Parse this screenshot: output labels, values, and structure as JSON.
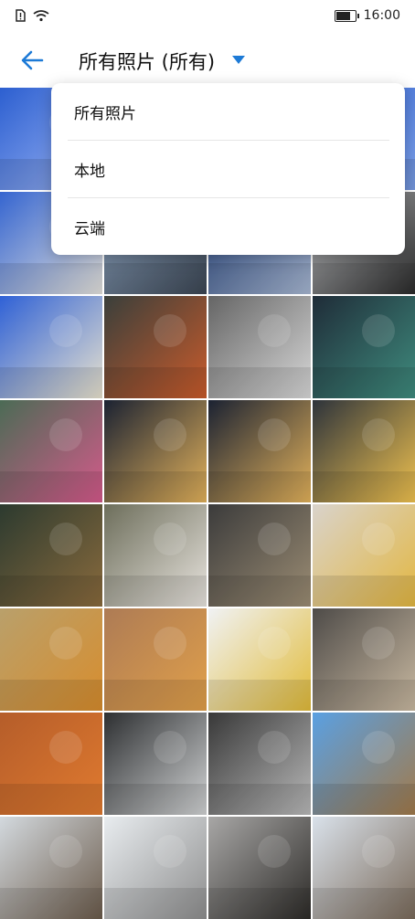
{
  "status_bar": {
    "time": "16:00",
    "icons": [
      "sim-alert-icon",
      "wifi-icon",
      "battery-icon"
    ]
  },
  "header": {
    "back_icon": "back-arrow-icon",
    "title": "所有照片 (所有)",
    "dropdown_icon": "caret-down-icon",
    "accent": "#1d7ad6"
  },
  "dropdown": {
    "options": [
      "所有照片",
      "本地",
      "云端"
    ]
  },
  "photos": [
    {
      "colors": [
        "#2c5fd0",
        "#9fb7f5"
      ]
    },
    {
      "colors": [
        "#2e5fce",
        "#7da1ea"
      ]
    },
    {
      "colors": [
        "#2e5fce",
        "#7da1ea"
      ]
    },
    {
      "colors": [
        "#2e5fce",
        "#7da1ea"
      ]
    },
    {
      "colors": [
        "#3565d0",
        "#e4e2dd"
      ]
    },
    {
      "colors": [
        "#8ea6c3",
        "#3b4552"
      ]
    },
    {
      "colors": [
        "#1f3c74",
        "#a7b7d2"
      ]
    },
    {
      "colors": [
        "#bfc1c4",
        "#2a2a2a"
      ]
    },
    {
      "colors": [
        "#2f61d6",
        "#e9e3cf"
      ]
    },
    {
      "colors": [
        "#3a3f3b",
        "#c95b2b"
      ]
    },
    {
      "colors": [
        "#656565",
        "#d8d8d8"
      ]
    },
    {
      "colors": [
        "#1f2c38",
        "#3f8c7e"
      ]
    },
    {
      "colors": [
        "#4b6b55",
        "#d55a8b"
      ]
    },
    {
      "colors": [
        "#1b2232",
        "#e3b25b"
      ]
    },
    {
      "colors": [
        "#1b2232",
        "#e3b25b"
      ]
    },
    {
      "colors": [
        "#2d333b",
        "#f0c24f"
      ]
    },
    {
      "colors": [
        "#2c3a2f",
        "#8a6b3d"
      ]
    },
    {
      "colors": [
        "#6d6e5b",
        "#e8e4de"
      ]
    },
    {
      "colors": [
        "#3b3b3b",
        "#9c8d74"
      ]
    },
    {
      "colors": [
        "#d9d3cb",
        "#e3b741"
      ]
    },
    {
      "colors": [
        "#b9a06b",
        "#d88d2d"
      ]
    },
    {
      "colors": [
        "#ad7b55",
        "#e1a04a"
      ]
    },
    {
      "colors": [
        "#f0f2f4",
        "#e1bb39"
      ]
    },
    {
      "colors": [
        "#4e4b48",
        "#c9b9a1"
      ]
    },
    {
      "colors": [
        "#b55d2a",
        "#e07a2f"
      ]
    },
    {
      "colors": [
        "#2d2f31",
        "#d1d3d4"
      ]
    },
    {
      "colors": [
        "#383838",
        "#b9b9b9"
      ]
    },
    {
      "colors": [
        "#5aa0e2",
        "#a27a4a"
      ]
    },
    {
      "colors": [
        "#d3d9de",
        "#6b5b4b"
      ]
    },
    {
      "colors": [
        "#e8ecef",
        "#8e8e8e"
      ]
    },
    {
      "colors": [
        "#a8a7a6",
        "#2d2b28"
      ]
    },
    {
      "colors": [
        "#d9e1ea",
        "#7a6a5a"
      ]
    }
  ]
}
